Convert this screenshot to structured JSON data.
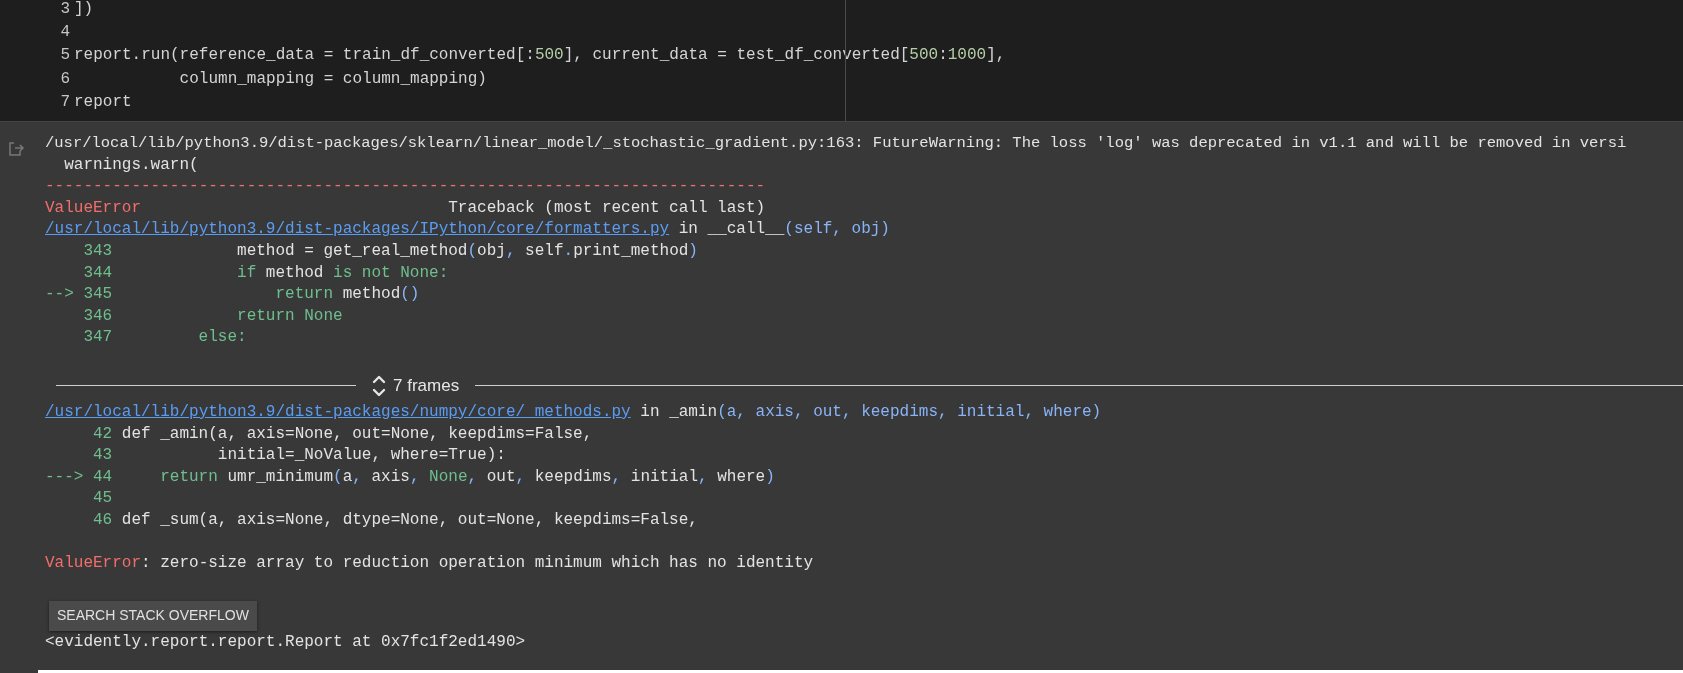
{
  "code_cell": {
    "lines": [
      {
        "number": "3",
        "tokens": [
          {
            "kind": "plain",
            "text": "])"
          }
        ]
      },
      {
        "number": "4"
      },
      {
        "number": "5",
        "tokens": [
          {
            "kind": "plain",
            "text": "report.run(reference_data = train_df_converted[:"
          },
          {
            "kind": "number",
            "text": "500"
          },
          {
            "kind": "plain",
            "text": "], current_data = test_df_converted["
          },
          {
            "kind": "number",
            "text": "500"
          },
          {
            "kind": "plain",
            "text": ":"
          },
          {
            "kind": "number",
            "text": "1000"
          },
          {
            "kind": "plain",
            "text": "],"
          }
        ]
      },
      {
        "number": "6",
        "tokens": [
          {
            "kind": "plain",
            "text": "           column_mapping = column_mapping)"
          }
        ]
      },
      {
        "number": "7",
        "tokens": [
          {
            "kind": "plain",
            "text": "report"
          }
        ]
      }
    ]
  },
  "output": {
    "warning_lines": [
      "/usr/local/lib/python3.9/dist-packages/sklearn/linear_model/_stochastic_gradient.py:163: FutureWarning: The loss 'log' was deprecated in v1.1 and will be removed in versi",
      "  warnings.warn("
    ],
    "separator": "---------------------------------------------------------------------------",
    "error_header": {
      "name": "ValueError",
      "label": "Traceback (most recent call last)"
    },
    "frames": [
      {
        "file": "/usr/local/lib/python3.9/dist-packages/IPython/core/formatters.py",
        "connector": "in",
        "function": "__call__",
        "arguments": "(self, obj)",
        "lines": [
          {
            "number": "343",
            "tokens": [
              {
                "kind": "plain",
                "text": "             method = get_real_method"
              },
              {
                "kind": "punct",
                "text": "("
              },
              {
                "kind": "plain",
                "text": "obj"
              },
              {
                "kind": "punct",
                "text": ","
              },
              {
                "kind": "plain",
                "text": " self"
              },
              {
                "kind": "punct",
                "text": "."
              },
              {
                "kind": "plain",
                "text": "print_method"
              },
              {
                "kind": "punct",
                "text": ")"
              }
            ]
          },
          {
            "number": "344",
            "tokens": [
              {
                "kind": "keyword",
                "text": "             if"
              },
              {
                "kind": "plain",
                "text": " method "
              },
              {
                "kind": "keyword",
                "text": "is not None:"
              }
            ]
          },
          {
            "marker": "-->",
            "number": "345",
            "tokens": [
              {
                "kind": "keyword",
                "text": "                 return"
              },
              {
                "kind": "plain",
                "text": " method"
              },
              {
                "kind": "punct",
                "text": "()"
              }
            ]
          },
          {
            "number": "346",
            "tokens": [
              {
                "kind": "keyword",
                "text": "             return None"
              }
            ]
          },
          {
            "number": "347",
            "tokens": [
              {
                "kind": "keyword",
                "text": "         else:"
              }
            ]
          }
        ]
      },
      {
        "collapsed_label": "7 frames"
      },
      {
        "file": "/usr/local/lib/python3.9/dist-packages/numpy/core/_methods.py",
        "connector": "in",
        "function": "_amin",
        "arguments": "(a, axis, out, keepdims, initial, where)",
        "lines": [
          {
            "number": "42",
            "tokens": [
              {
                "kind": "plain",
                "text": " def _amin(a, axis=None, out=None, keepdims=False,"
              }
            ]
          },
          {
            "number": "43",
            "tokens": [
              {
                "kind": "plain",
                "text": "           initial=_NoValue, where=True):"
              }
            ]
          },
          {
            "marker": "--->",
            "number": "44",
            "tokens": [
              {
                "kind": "keyword",
                "text": "     return"
              },
              {
                "kind": "plain",
                "text": " umr_minimum"
              },
              {
                "kind": "punct",
                "text": "("
              },
              {
                "kind": "plain",
                "text": "a"
              },
              {
                "kind": "punct",
                "text": ","
              },
              {
                "kind": "plain",
                "text": " axis"
              },
              {
                "kind": "punct",
                "text": ","
              },
              {
                "kind": "keyword",
                "text": " None"
              },
              {
                "kind": "punct",
                "text": ","
              },
              {
                "kind": "plain",
                "text": " out"
              },
              {
                "kind": "punct",
                "text": ","
              },
              {
                "kind": "plain",
                "text": " keepdims"
              },
              {
                "kind": "punct",
                "text": ","
              },
              {
                "kind": "plain",
                "text": " initial"
              },
              {
                "kind": "punct",
                "text": ","
              },
              {
                "kind": "plain",
                "text": " where"
              },
              {
                "kind": "punct",
                "text": ")"
              }
            ]
          },
          {
            "number": "45"
          },
          {
            "number": "46",
            "tokens": [
              {
                "kind": "plain",
                "text": " def _sum(a, axis=None, dtype=None, out=None, keepdims=False,"
              }
            ]
          }
        ]
      }
    ],
    "error": {
      "name": "ValueError",
      "message": ": zero-size array to reduction operation minimum which has no identity"
    },
    "search_button": "SEARCH STACK OVERFLOW",
    "result": "<evidently.report.report.Report at 0x7fc1f2ed1490>"
  }
}
